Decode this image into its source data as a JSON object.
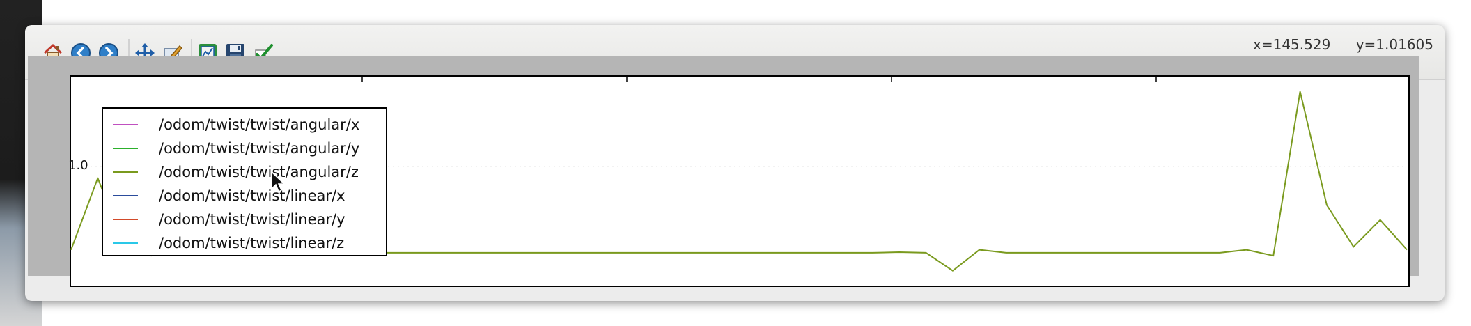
{
  "toolbar": {
    "buttons": [
      {
        "name": "home-button",
        "icon": "home-icon"
      },
      {
        "name": "back-button",
        "icon": "back-arrow-icon"
      },
      {
        "name": "forward-button",
        "icon": "forward-arrow-icon"
      },
      {
        "name": "pan-button",
        "icon": "pan-move-icon"
      },
      {
        "name": "zoom-button",
        "icon": "zoom-edit-icon"
      },
      {
        "name": "configure-subplots-button",
        "icon": "subplot-config-icon"
      },
      {
        "name": "save-button",
        "icon": "save-disk-icon"
      },
      {
        "name": "apply-button",
        "icon": "checkmark-icon"
      }
    ],
    "coords": {
      "x": "x=145.529",
      "y": "y=1.01605"
    }
  },
  "plot": {
    "ytick_labels": [
      "1.0"
    ],
    "legend": [
      {
        "label": "/odom/twist/twist/angular/x",
        "color": "#c050c0"
      },
      {
        "label": "/odom/twist/twist/angular/y",
        "color": "#2cb02c"
      },
      {
        "label": "/odom/twist/twist/angular/z",
        "color": "#7a9a1e"
      },
      {
        "label": "/odom/twist/twist/linear/x",
        "color": "#2b4c9c"
      },
      {
        "label": "/odom/twist/twist/linear/y",
        "color": "#d24a2a"
      },
      {
        "label": "/odom/twist/twist/linear/z",
        "color": "#2ac8e8"
      }
    ]
  },
  "chart_data": {
    "type": "line",
    "ytick_labels": [
      "1.0"
    ],
    "legend_placement": "upper-left",
    "grid": true,
    "series": [
      {
        "name": "/odom/twist/twist/angular/z",
        "x": [
          0,
          1,
          2,
          3,
          4,
          5,
          6,
          7,
          8,
          9,
          10,
          11,
          12,
          13,
          14,
          15,
          16,
          17,
          18,
          19,
          20,
          21,
          22,
          23,
          24,
          25,
          26,
          27,
          28,
          29,
          30,
          31,
          32,
          33,
          34,
          35,
          36,
          37,
          38,
          39,
          40,
          41,
          42,
          43,
          44,
          45,
          46,
          47,
          48,
          49,
          50
        ],
        "y": [
          0.72,
          0.96,
          0.73,
          0.7,
          0.71,
          0.71,
          0.71,
          0.71,
          0.71,
          0.71,
          0.71,
          0.71,
          0.71,
          0.71,
          0.71,
          0.71,
          0.71,
          0.71,
          0.71,
          0.71,
          0.71,
          0.71,
          0.71,
          0.71,
          0.71,
          0.71,
          0.71,
          0.71,
          0.71,
          0.71,
          0.71,
          0.712,
          0.71,
          0.65,
          0.72,
          0.71,
          0.71,
          0.71,
          0.71,
          0.71,
          0.71,
          0.71,
          0.71,
          0.71,
          0.72,
          0.7,
          1.25,
          0.87,
          0.73,
          0.82,
          0.72
        ]
      }
    ]
  }
}
